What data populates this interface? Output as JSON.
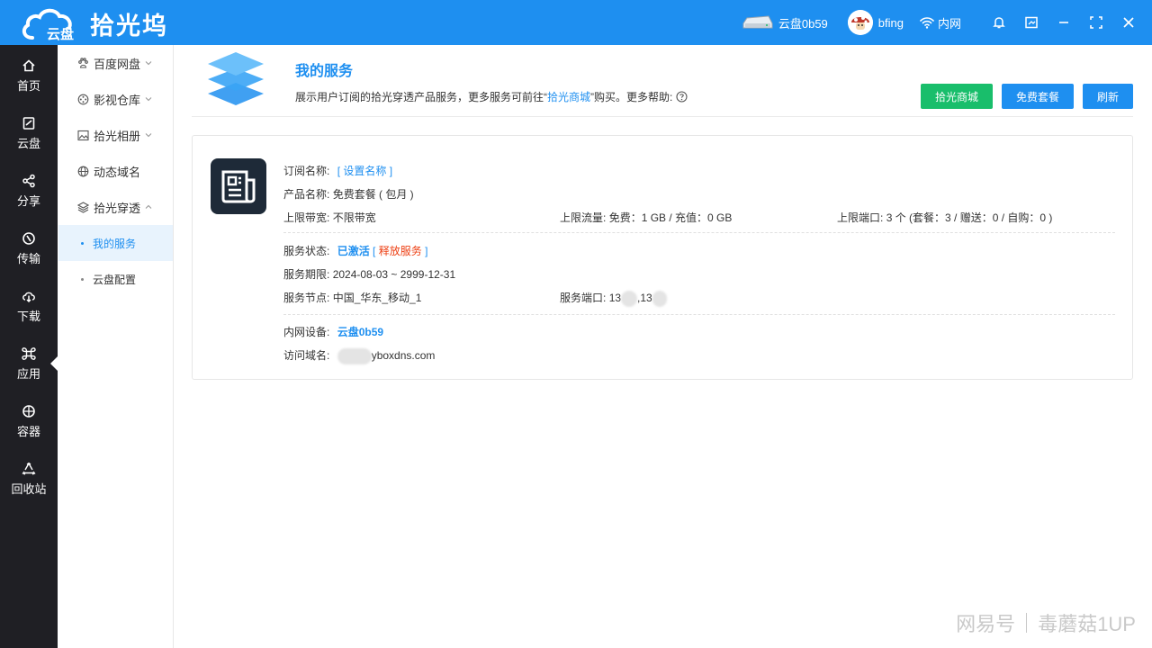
{
  "app": {
    "title": "拾光坞",
    "logo_text": "云盘",
    "brand_color": "#1e8ff0"
  },
  "topbar": {
    "device_name": "云盘0b59",
    "username": "bfing",
    "network_label": "内网",
    "icons": [
      "drive-icon",
      "avatar",
      "wifi-icon",
      "bell-icon",
      "screen-icon",
      "minimize-icon",
      "maximize-icon",
      "close-icon"
    ]
  },
  "leftnav": {
    "items": [
      {
        "label": "首页",
        "icon": "home-icon"
      },
      {
        "label": "云盘",
        "icon": "disk-icon"
      },
      {
        "label": "分享",
        "icon": "share-icon"
      },
      {
        "label": "传输",
        "icon": "transfer-icon"
      },
      {
        "label": "下载",
        "icon": "download-icon"
      },
      {
        "label": "应用",
        "icon": "apps-icon"
      },
      {
        "label": "容器",
        "icon": "container-icon"
      },
      {
        "label": "回收站",
        "icon": "recycle-icon"
      }
    ],
    "active": "应用"
  },
  "submenu": {
    "items": [
      {
        "label": "百度网盘",
        "icon": "baidu-icon",
        "expandable": true
      },
      {
        "label": "影视仓库",
        "icon": "film-icon",
        "expandable": true
      },
      {
        "label": "拾光相册",
        "icon": "photo-icon",
        "expandable": true
      },
      {
        "label": "动态域名",
        "icon": "globe-icon",
        "expandable": false
      },
      {
        "label": "拾光穿透",
        "icon": "layers-icon",
        "expandable": true
      }
    ],
    "children": [
      {
        "label": "我的服务",
        "active": true
      },
      {
        "label": "云盘配置",
        "active": false
      }
    ]
  },
  "header": {
    "title": "我的服务",
    "desc_prefix": "展示用户订阅的拾光穿透产品服务，更多服务可前往“",
    "desc_link": "拾光商城",
    "desc_suffix": "”购买。更多帮助:",
    "buttons": {
      "store": "拾光商城",
      "free_plan": "免费套餐",
      "refresh": "刷新"
    }
  },
  "service": {
    "sub_name_label": "订阅名称:",
    "sub_name_open": "[",
    "sub_name_link": "设置名称",
    "sub_name_close": "]",
    "product_label": "产品名称:",
    "product_value": "免费套餐 ( 包月 )",
    "bandwidth_label": "上限带宽:",
    "bandwidth_value": "不限带宽",
    "traffic_label": "上限流量:",
    "traffic_value": "免费：1 GB / 充值：0 GB",
    "ports_label": "上限端口:",
    "ports_value": "3 个 (套餐：3 / 赠送：0 / 自购：0 )",
    "status_label": "服务状态:",
    "status_value": "已激活",
    "release_open": "[",
    "release_link": "释放服务",
    "release_close": "]",
    "period_label": "服务期限:",
    "period_value": "2024-08-03 ~ 2999-12-31",
    "node_label": "服务节点:",
    "node_value": "中国_华东_移动_1",
    "service_port_label": "服务端口:",
    "service_port_a": "13",
    "service_port_sep": ",13",
    "lan_device_label": "内网设备:",
    "lan_device_value": "云盘0b59",
    "domain_label": "访问域名:",
    "domain_suffix": "yboxdns.com"
  },
  "watermark": {
    "left": "网易号",
    "right": "毒蘑菇1UP"
  }
}
